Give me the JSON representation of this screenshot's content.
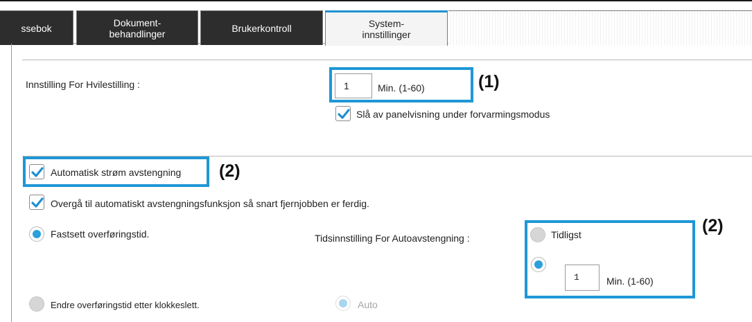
{
  "tabs": [
    {
      "label": "ssebok",
      "active": false
    },
    {
      "label": "Dokument-\nbehandlinger",
      "active": false
    },
    {
      "label": "Brukerkontroll",
      "active": false
    },
    {
      "label": "System-\ninnstillinger",
      "active": true
    }
  ],
  "sleep": {
    "label": "Innstilling For Hvilestilling :",
    "value": "1",
    "unit": "Min. (1-60)",
    "panel_checkbox_label": "Slå av panelvisning under forvarmingsmodus",
    "panel_checkbox_checked": true
  },
  "auto_power_off": {
    "checkbox_label": "Automatisk strøm avstengning",
    "checked": true,
    "remote_job_label": "Overgå til automatiskt avstengningsfunksjon så snart fjernjobben er ferdig.",
    "remote_job_checked": true,
    "fixed_time_label": "Fastsett overføringstid.",
    "fixed_time_selected": true,
    "timing_label": "Tidsinnstilling For Autoavstengning :",
    "earliest_label": "Tidligst",
    "earliest_selected": false,
    "minutes_selected": true,
    "minutes_value": "1",
    "minutes_unit": "Min. (1-60)",
    "by_clock_label": "Endre overføringstid etter klokkeslett.",
    "by_clock_selected": false,
    "auto_label": "Auto"
  },
  "callouts": {
    "one": "(1)",
    "two": "(2)"
  },
  "colors": {
    "accent": "#2aa0dc",
    "highlight": "#1e97d6",
    "tab_dark": "#2d2d2d"
  }
}
